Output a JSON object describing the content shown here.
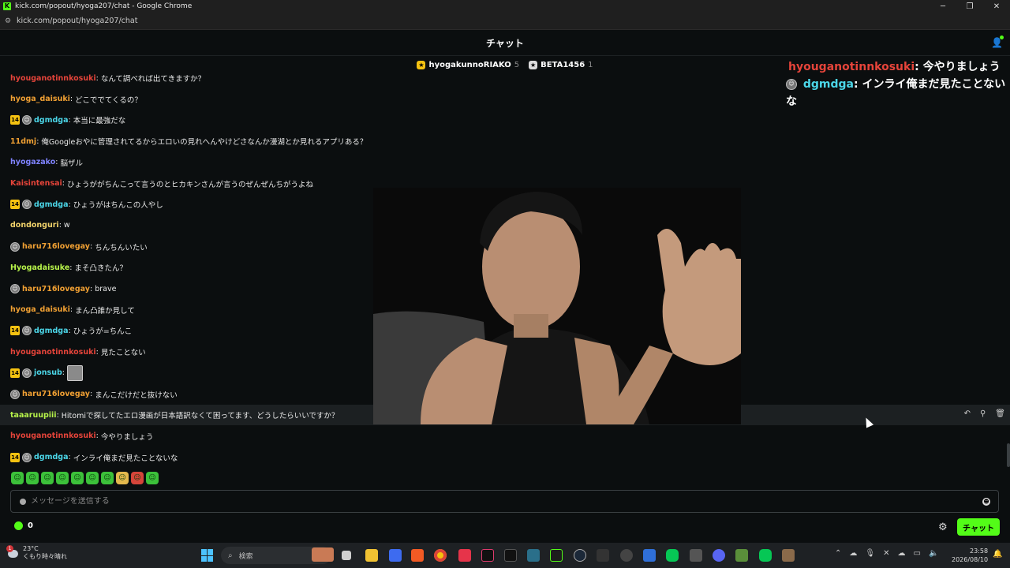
{
  "window": {
    "title": "kick.com/popout/hyoga207/chat - Google Chrome",
    "url": "kick.com/popout/hyoga207/chat"
  },
  "chat": {
    "header_title": "チャット",
    "leaders": [
      {
        "name": "hyogakunnoRIAKO",
        "count": "5",
        "color": "#f5c211"
      },
      {
        "name": "BETA1456",
        "count": "1",
        "color": "#dcdcdc"
      }
    ],
    "messages": [
      {
        "badges": [],
        "user": "hyouganotinnkosuki",
        "color": "#e5443a",
        "text": "なんて調べれば出てきますか？"
      },
      {
        "badges": [],
        "user": "hyoga_daisuki",
        "color": "#f0a033",
        "text": "どこででてくるの？"
      },
      {
        "badges": [
          "14",
          "av"
        ],
        "user": "dgmdga",
        "color": "#4bd6e8",
        "text": "本当に最強だな"
      },
      {
        "badges": [],
        "user": "11dmj",
        "color": "#f0a033",
        "text": "俺Googleおやに管理されてるからエロいの見れへんやけどさなんか漫湖とか見れるアプリある？"
      },
      {
        "badges": [],
        "user": "hyogazako",
        "color": "#7f83ff",
        "text": "脳ザル"
      },
      {
        "badges": [],
        "user": "Kaisintensai",
        "color": "#e5443a",
        "text": "ひょうががちんこって言うのとヒカキンさんが言うのぜんぜんちがうよね"
      },
      {
        "badges": [
          "14",
          "av"
        ],
        "user": "dgmdga",
        "color": "#4bd6e8",
        "text": "ひょうがはちんこの人やし"
      },
      {
        "badges": [],
        "user": "dondonguri",
        "color": "#f2d36b",
        "text": "w"
      },
      {
        "badges": [
          "av"
        ],
        "user": "haru716lovegay",
        "color": "#f0a033",
        "text": "ちんちんいたい"
      },
      {
        "badges": [],
        "user": "Hyogadaisuke",
        "color": "#b7f34a",
        "text": "まそ凸きたん？"
      },
      {
        "badges": [
          "av"
        ],
        "user": "haru716lovegay",
        "color": "#f0a033",
        "text": "brave"
      },
      {
        "badges": [],
        "user": "hyoga_daisuki",
        "color": "#f0a033",
        "text": "まん凸誰か見して"
      },
      {
        "badges": [
          "14",
          "av"
        ],
        "user": "dgmdga",
        "color": "#4bd6e8",
        "text": "ひょうが=ちんこ"
      },
      {
        "badges": [],
        "user": "hyouganotinnkosuki",
        "color": "#e5443a",
        "text": "見たことない"
      },
      {
        "badges": [
          "14",
          "av"
        ],
        "user": "jonsub",
        "color": "#4bd6e8",
        "text": ""
      },
      {
        "badges": [
          "av"
        ],
        "user": "haru716lovegay",
        "color": "#f0a033",
        "text": "まんこだけだと抜けない"
      },
      {
        "badges": [],
        "user": "taaaruupiii",
        "color": "#b7f34a",
        "text": "Hitomiで探してたエロ漫画が日本語訳なくて困ってます、どうしたらいいですか？"
      },
      {
        "badges": [],
        "user": "hyouganotinnkosuki",
        "color": "#e5443a",
        "text": "今やりましょう"
      },
      {
        "badges": [
          "14",
          "av"
        ],
        "user": "dgmdga",
        "color": "#4bd6e8",
        "text": "インライ俺まだ見たことないな"
      }
    ],
    "overlay": [
      {
        "user": "hyouganotinnkosuki",
        "color": "#e5443a",
        "text": "今やりましょう"
      },
      {
        "user": "dgmdga",
        "color": "#4bd6e8",
        "text": "インライ俺まだ見たことないな"
      }
    ],
    "input_placeholder": "メッセージを送信する",
    "points": "0",
    "send_label": "チャット",
    "sub_badge": "14",
    "sep": ": "
  },
  "taskbar": {
    "weather_temp": "23°C",
    "weather_desc": "くもり時々晴れ",
    "weather_alert": "1",
    "search_placeholder": "検索",
    "time": "23:58",
    "date": "2026/08/10"
  }
}
